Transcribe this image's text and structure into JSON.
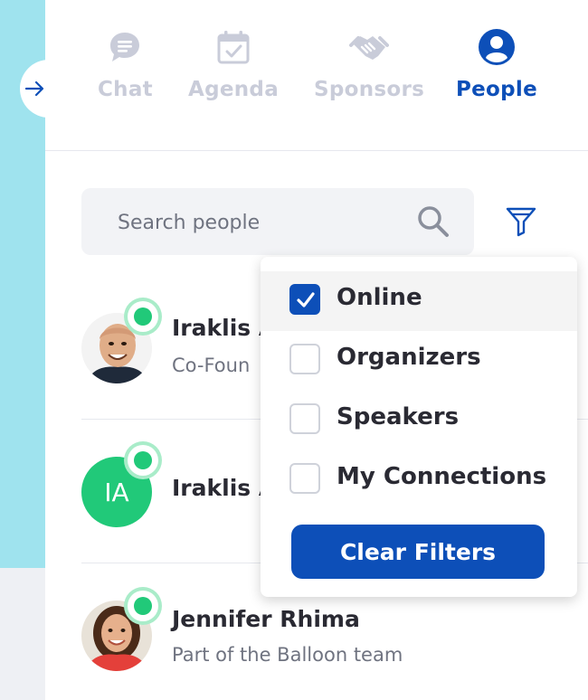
{
  "tabs": [
    {
      "label": "Chat",
      "icon": "chat-bubble-icon",
      "active": false
    },
    {
      "label": "Agenda",
      "icon": "calendar-check-icon",
      "active": false
    },
    {
      "label": "Sponsors",
      "icon": "handshake-icon",
      "active": false
    },
    {
      "label": "People",
      "icon": "user-circle-icon",
      "active": true
    }
  ],
  "search": {
    "placeholder": "Search people"
  },
  "people": [
    {
      "name": "Iraklis A",
      "title": "Co-Foun",
      "avatar": "photo",
      "online": true
    },
    {
      "name": "Iraklis A",
      "initials": "IA",
      "avatar": "initials",
      "online": true
    },
    {
      "name": "Jennifer Rhima",
      "title": "Part of the Balloon team",
      "avatar": "photo",
      "online": true
    }
  ],
  "filters": {
    "options": [
      {
        "label": "Online",
        "checked": true
      },
      {
        "label": "Organizers",
        "checked": false
      },
      {
        "label": "Speakers",
        "checked": false
      },
      {
        "label": "My Connections",
        "checked": false
      }
    ],
    "clear_label": "Clear Filters"
  },
  "colors": {
    "accent": "#0d4fb8",
    "online": "#21c979",
    "inactive_tab": "#c9ccd9",
    "side_strip": "#9fe3ee"
  }
}
